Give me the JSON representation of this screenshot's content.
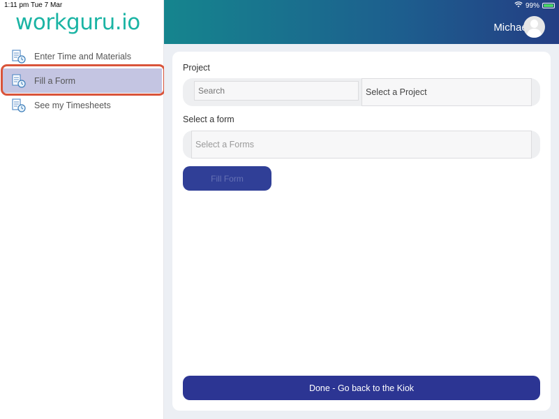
{
  "status_bar": {
    "time": "1:11 pm   Tue 7 Mar",
    "battery": "99%"
  },
  "sidebar": {
    "logo": "workguru.io",
    "items": [
      {
        "label": "Enter Time and Materials",
        "icon": "timesheet-icon"
      },
      {
        "label": "Fill a Form",
        "icon": "timesheet-icon",
        "active": true
      },
      {
        "label": "See my Timesheets",
        "icon": "timesheet-icon"
      }
    ]
  },
  "header": {
    "user_name": "Michael"
  },
  "form": {
    "project_label": "Project",
    "search_placeholder": "Search",
    "project_select": "Select a Project",
    "form_label": "Select a form",
    "form_select": "Select a Forms",
    "fill_button": "Fill Form",
    "done_button": "Done - Go back to the Kiok"
  },
  "colors": {
    "accent": "#2c3593",
    "brand": "#1bb4a4",
    "highlight": "#d9543a"
  }
}
